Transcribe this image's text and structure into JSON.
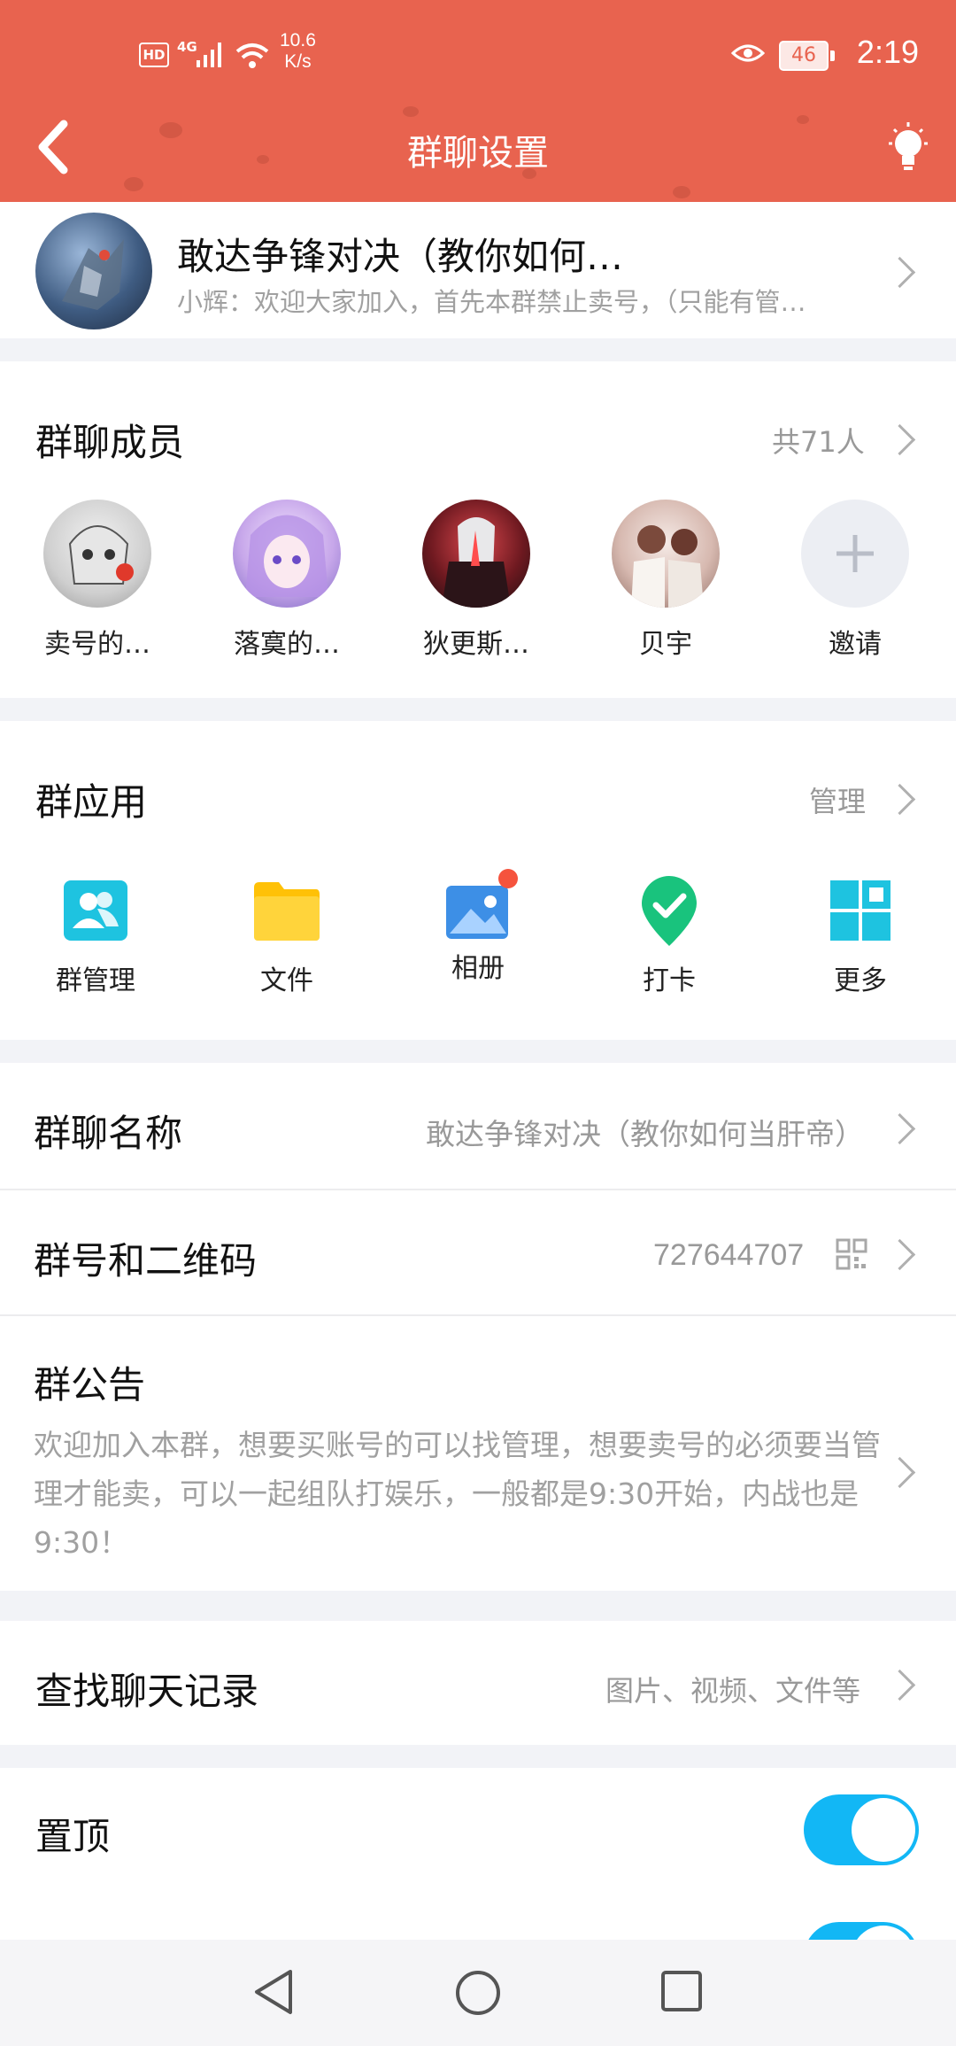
{
  "status_bar": {
    "hd": "HD",
    "network": "4G",
    "speed_value": "10.6",
    "speed_unit": "K/s",
    "battery": "46",
    "time": "2:19"
  },
  "header": {
    "title": "群聊设置"
  },
  "group": {
    "name": "敢达争锋对决（教你如何…",
    "preview": "小辉：欢迎大家加入，首先本群禁止卖号，（只能有管…"
  },
  "members": {
    "title": "群聊成员",
    "count": "共71人",
    "list": [
      {
        "name": "卖号的…"
      },
      {
        "name": "落寞的…"
      },
      {
        "name": "狄更斯…"
      },
      {
        "name": "贝宇"
      }
    ],
    "invite": "邀请"
  },
  "apps": {
    "title": "群应用",
    "manage": "管理",
    "items": [
      {
        "label": "群管理",
        "icon": "group-manage-icon"
      },
      {
        "label": "文件",
        "icon": "folder-icon"
      },
      {
        "label": "相册",
        "icon": "album-icon"
      },
      {
        "label": "打卡",
        "icon": "checkin-icon"
      },
      {
        "label": "更多",
        "icon": "more-grid-icon"
      }
    ]
  },
  "settings": {
    "name_label": "群聊名称",
    "name_value": "敢达争锋对决（教你如何当肝帝）",
    "number_label": "群号和二维码",
    "number_value": "727644707",
    "notice_label": "群公告",
    "notice_text": "欢迎加入本群，想要买账号的可以找管理，想要卖号的必须要当管理才能卖，可以一起组队打娱乐，一般都是9:30开始，内战也是9:30！",
    "search_label": "查找聊天记录",
    "search_hint": "图片、视频、文件等",
    "pin_label": "置顶"
  },
  "colors": {
    "header": "#e8634f",
    "toggle_on": "#12b7f5",
    "app_teal": "#1ec3e0",
    "folder": "#ffc107",
    "album": "#3d8fe6",
    "checkin": "#19c37d",
    "badge": "#f5533d"
  }
}
